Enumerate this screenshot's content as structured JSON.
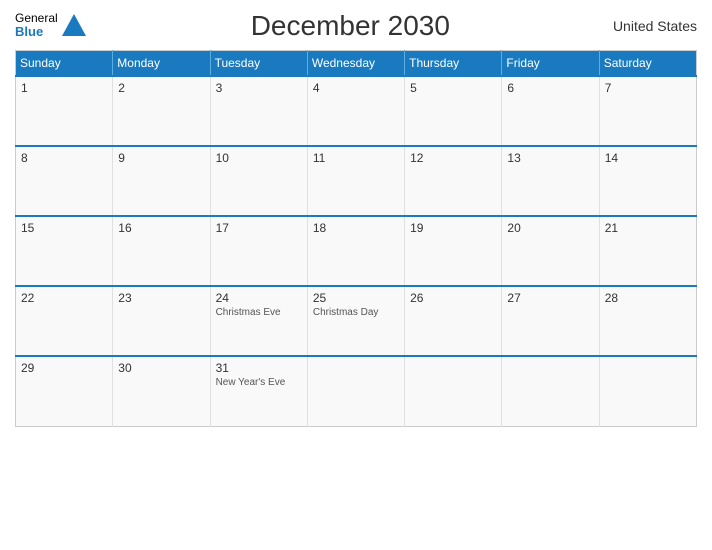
{
  "header": {
    "title": "December 2030",
    "country": "United States"
  },
  "logo": {
    "general": "General",
    "blue": "Blue"
  },
  "days": [
    "Sunday",
    "Monday",
    "Tuesday",
    "Wednesday",
    "Thursday",
    "Friday",
    "Saturday"
  ],
  "weeks": [
    [
      {
        "num": "1",
        "holiday": ""
      },
      {
        "num": "2",
        "holiday": ""
      },
      {
        "num": "3",
        "holiday": ""
      },
      {
        "num": "4",
        "holiday": ""
      },
      {
        "num": "5",
        "holiday": ""
      },
      {
        "num": "6",
        "holiday": ""
      },
      {
        "num": "7",
        "holiday": ""
      }
    ],
    [
      {
        "num": "8",
        "holiday": ""
      },
      {
        "num": "9",
        "holiday": ""
      },
      {
        "num": "10",
        "holiday": ""
      },
      {
        "num": "11",
        "holiday": ""
      },
      {
        "num": "12",
        "holiday": ""
      },
      {
        "num": "13",
        "holiday": ""
      },
      {
        "num": "14",
        "holiday": ""
      }
    ],
    [
      {
        "num": "15",
        "holiday": ""
      },
      {
        "num": "16",
        "holiday": ""
      },
      {
        "num": "17",
        "holiday": ""
      },
      {
        "num": "18",
        "holiday": ""
      },
      {
        "num": "19",
        "holiday": ""
      },
      {
        "num": "20",
        "holiday": ""
      },
      {
        "num": "21",
        "holiday": ""
      }
    ],
    [
      {
        "num": "22",
        "holiday": ""
      },
      {
        "num": "23",
        "holiday": ""
      },
      {
        "num": "24",
        "holiday": "Christmas Eve"
      },
      {
        "num": "25",
        "holiday": "Christmas Day"
      },
      {
        "num": "26",
        "holiday": ""
      },
      {
        "num": "27",
        "holiday": ""
      },
      {
        "num": "28",
        "holiday": ""
      }
    ],
    [
      {
        "num": "29",
        "holiday": ""
      },
      {
        "num": "30",
        "holiday": ""
      },
      {
        "num": "31",
        "holiday": "New Year's Eve"
      },
      {
        "num": "",
        "holiday": ""
      },
      {
        "num": "",
        "holiday": ""
      },
      {
        "num": "",
        "holiday": ""
      },
      {
        "num": "",
        "holiday": ""
      }
    ]
  ]
}
